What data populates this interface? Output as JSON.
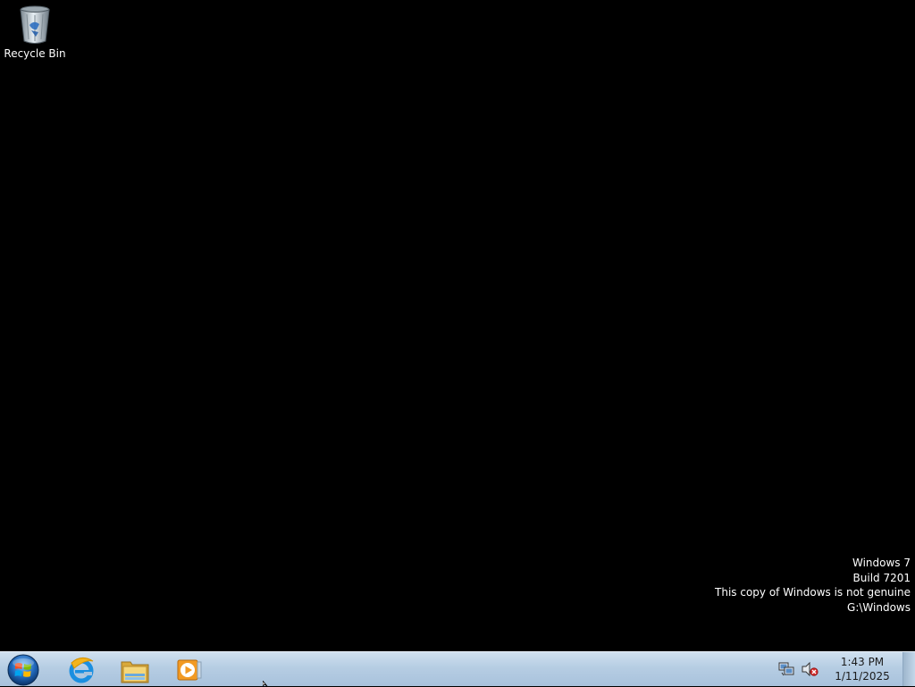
{
  "desktop": {
    "icons": [
      {
        "label": "Recycle Bin",
        "icon": "recycle-bin-icon"
      }
    ],
    "watermark": {
      "line1": "Windows 7",
      "line2": "Build 7201",
      "line3": "This copy of Windows is not genuine",
      "line4": "G:\\Windows"
    },
    "background_color": "#000000"
  },
  "taskbar": {
    "start_icon": "windows-orb-icon",
    "pinned": [
      {
        "icon": "internet-explorer-icon"
      },
      {
        "icon": "windows-explorer-icon"
      },
      {
        "icon": "media-player-icon"
      }
    ],
    "tray": {
      "icons": [
        "network-icon",
        "volume-muted-icon"
      ],
      "time": "1:43 PM",
      "date": "1/11/2025"
    }
  }
}
